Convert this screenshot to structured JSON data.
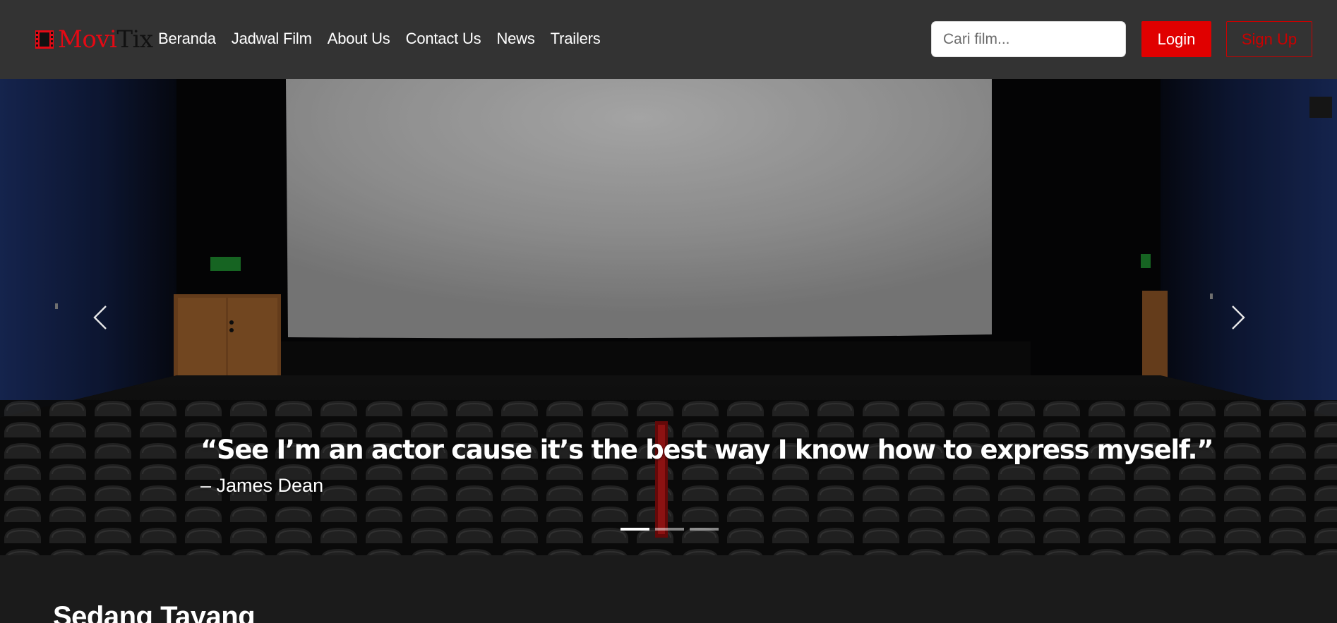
{
  "brand": {
    "part1": "Movi",
    "part2": "Tix"
  },
  "nav": {
    "links": [
      "Beranda",
      "Jadwal Film",
      "About Us",
      "Contact Us",
      "News",
      "Trailers"
    ]
  },
  "search": {
    "placeholder": "Cari film...",
    "value": ""
  },
  "auth": {
    "login_label": "Login",
    "signup_label": "Sign Up"
  },
  "carousel": {
    "slides_count": 3,
    "active_index": 0,
    "quote": "“See I’m an actor cause it’s the best way I know how to express myself.”",
    "author": "– James Dean",
    "prev_icon": "chevron-left-icon",
    "next_icon": "chevron-right-icon"
  },
  "section": {
    "title": "Sedang Tayang"
  },
  "colors": {
    "navbar_bg": "#333333",
    "accent_red": "#e00000",
    "page_bg": "#1b1b1b"
  }
}
